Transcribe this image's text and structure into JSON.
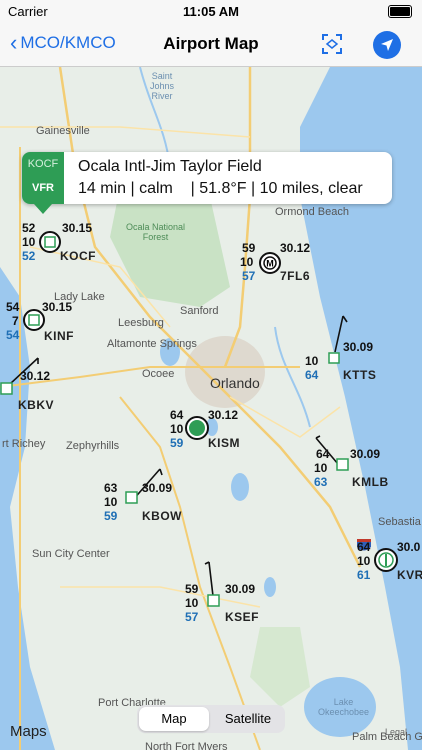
{
  "status": {
    "carrier": "Carrier",
    "time": "11:05 AM"
  },
  "nav": {
    "back_label": "MCO/KMCO",
    "title": "Airport Map"
  },
  "callout": {
    "id": "KOCF",
    "category": "VFR",
    "category_color": "#2e9d55",
    "name": "Ocala Intl-Jim Taylor Field",
    "details": "14 min | calm    | 51.8°F | 10 miles, clear"
  },
  "places": {
    "gainesville": "Gainesville",
    "ormond": "Ormond Beach",
    "lady_lake": "Lady Lake",
    "sanford": "Sanford",
    "leesburg": "Leesburg",
    "altamonte": "Altamonte Springs",
    "ocoee": "Ocoee",
    "orlando": "Orlando",
    "port_richey": "rt Richey",
    "zephyrhills": "Zephyrhills",
    "sun_city": "Sun City Center",
    "port_charlotte": "Port Charlotte",
    "north_fort_myers": "North Fort Myers",
    "palm_beach_gardens": "Palm Beach Gardens",
    "sebastian": "Sebastia",
    "st_johns_river": "Saint\nJohns\nRiver",
    "ocala_forest": "Ocala National\nForest",
    "lake_okeechobee": "Lake\nOkeechobee"
  },
  "stations": [
    {
      "id": "KOCF",
      "temp": "52",
      "vis": "10",
      "dew": "52",
      "press": "30.15",
      "cat": "VFR"
    },
    {
      "id": "7FL6",
      "temp": "59",
      "vis": "10",
      "dew": "57",
      "press": "30.12",
      "cat": "VFR"
    },
    {
      "id": "KINF",
      "temp": "54",
      "vis": "7",
      "dew": "54",
      "press": "30.15",
      "cat": "VFR"
    },
    {
      "id": "KTTS",
      "temp": "",
      "vis": "10",
      "dew": "64",
      "press": "30.09",
      "cat": "VFR"
    },
    {
      "id": "KBKV",
      "temp": "",
      "vis": "",
      "dew": "",
      "press": "30.12",
      "cat": "VFR"
    },
    {
      "id": "KISM",
      "temp": "64",
      "vis": "10",
      "dew": "59",
      "press": "30.12",
      "cat": "VFR"
    },
    {
      "id": "KMLB",
      "temp": "64",
      "vis": "10",
      "dew": "63",
      "press": "30.09",
      "cat": "VFR"
    },
    {
      "id": "KBOW",
      "temp": "63",
      "vis": "10",
      "dew": "59",
      "press": "30.09",
      "cat": "VFR"
    },
    {
      "id": "KVRB",
      "temp": "64",
      "vis": "10",
      "dew": "61",
      "press": "30.0",
      "cat": "VFR",
      "label": "KVR"
    },
    {
      "id": "KSEF",
      "temp": "59",
      "vis": "10",
      "dew": "57",
      "press": "30.09",
      "cat": "VFR"
    }
  ],
  "map_modes": {
    "map": "Map",
    "satellite": "Satellite",
    "selected": "Map"
  },
  "footer": {
    "maps_logo": "Maps",
    "legal": "Legal"
  },
  "colors": {
    "accent": "#1f6fe5",
    "vfr": "#2e9d55",
    "water": "#9cc8ee",
    "land": "#e8eee8"
  }
}
